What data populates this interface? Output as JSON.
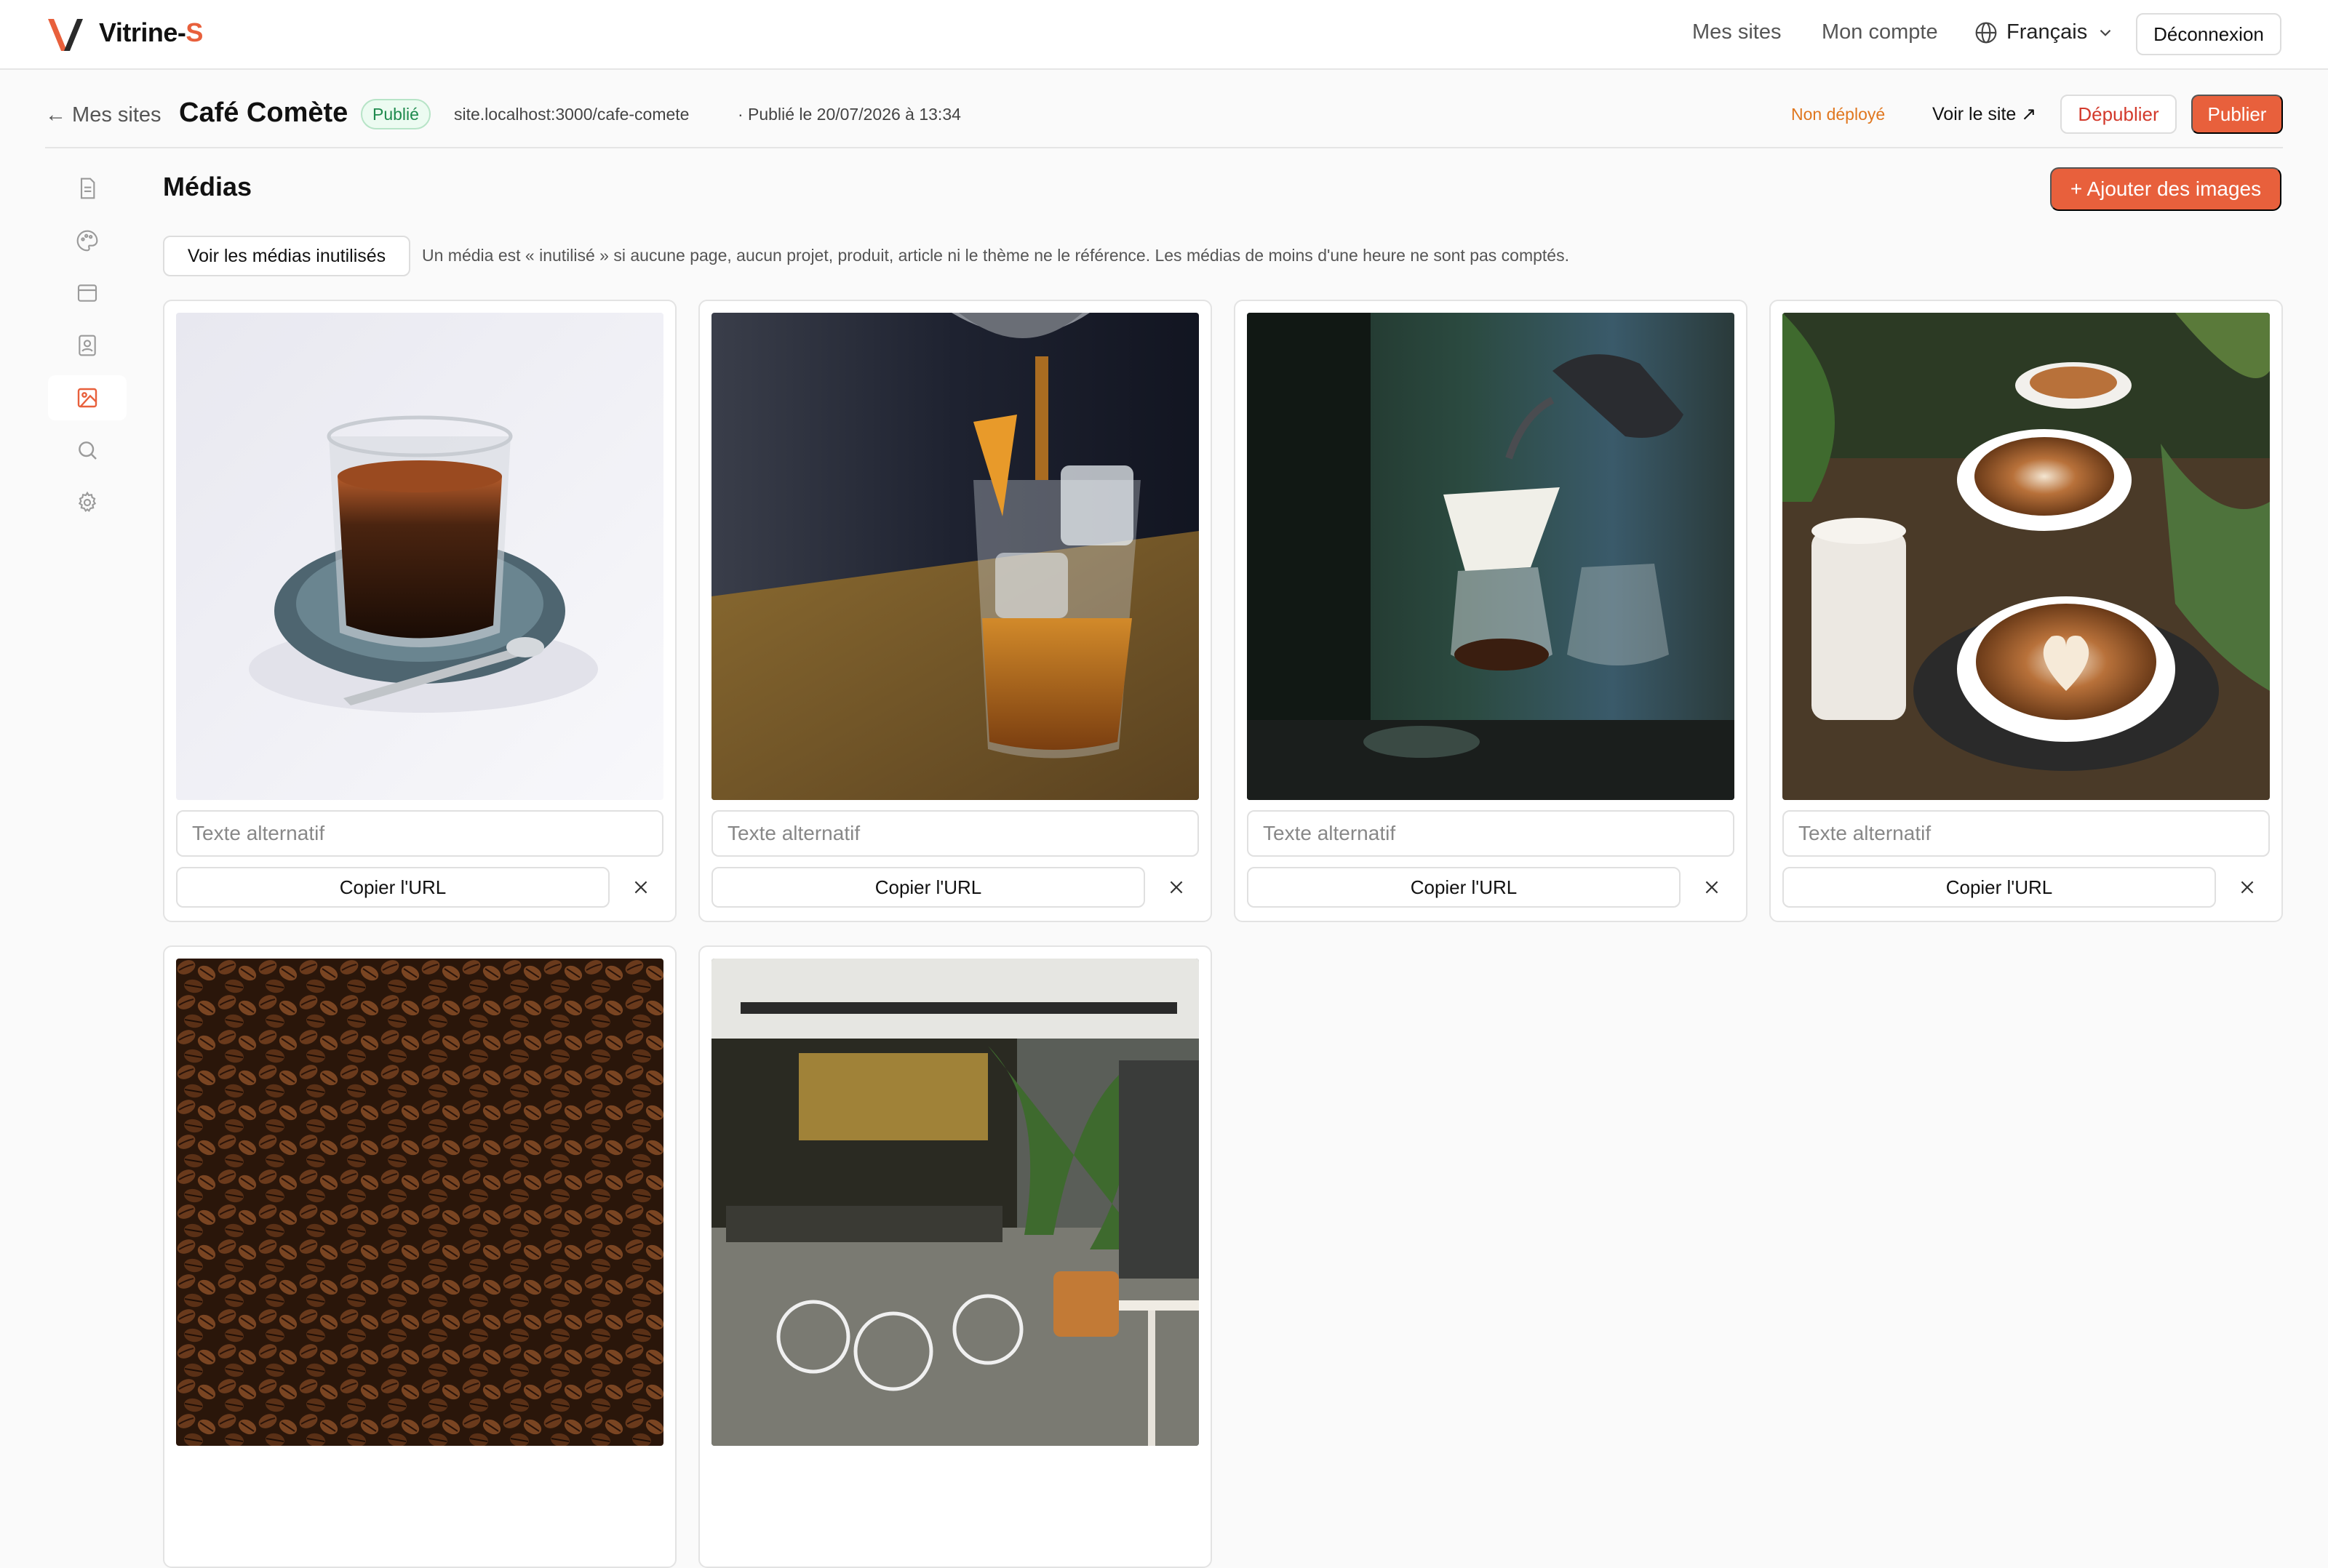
{
  "brand": {
    "name_main": "Vitrine-",
    "name_accent": "S",
    "accent_color": "#e8603c"
  },
  "topnav": {
    "my_sites": "Mes sites",
    "my_account": "Mon compte",
    "language": "Français",
    "logout": "Déconnexion"
  },
  "site": {
    "back_label": "← Mes sites",
    "name": "Café Comète",
    "status": "Publié",
    "url": "site.localhost:3000/cafe-comete",
    "published_at": "· Publié le 20/07/2026 à 13:34",
    "deploy_status": "Non déployé",
    "view_site": "Voir le site ↗",
    "unpublish": "Dépublier",
    "publish": "Publier"
  },
  "sidebar": {
    "items": [
      {
        "icon": "document-icon",
        "active": false
      },
      {
        "icon": "palette-icon",
        "active": false
      },
      {
        "icon": "layout-icon",
        "active": false
      },
      {
        "icon": "contact-icon",
        "active": false
      },
      {
        "icon": "image-icon",
        "active": true
      },
      {
        "icon": "search-icon",
        "active": false
      },
      {
        "icon": "gear-icon",
        "active": false
      }
    ]
  },
  "media": {
    "title": "Médias",
    "add_button": "+ Ajouter des images",
    "unused_button": "Voir les médias inutilisés",
    "unused_note": "Un média est « inutilisé » si aucune page, aucun projet, produit, article ni le thème ne le référence. Les médias de moins d'une heure ne sont pas comptés.",
    "alt_placeholder": "Texte alternatif",
    "copy_label": "Copier l'URL",
    "items": [
      {
        "subject": "espresso-glass"
      },
      {
        "subject": "iced-drink-pour"
      },
      {
        "subject": "pour-over-coffee"
      },
      {
        "subject": "latte-art-cups"
      },
      {
        "subject": "coffee-beans"
      },
      {
        "subject": "cafe-interior"
      }
    ]
  }
}
